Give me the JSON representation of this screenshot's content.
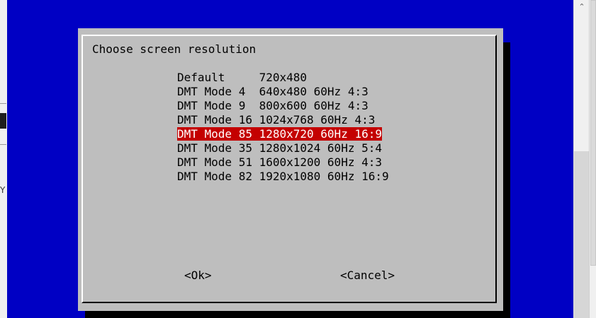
{
  "dialog": {
    "prompt": "Choose screen resolution",
    "items": [
      {
        "label": "Default     720x480"
      },
      {
        "label": "DMT Mode 4  640x480 60Hz 4:3"
      },
      {
        "label": "DMT Mode 9  800x600 60Hz 4:3"
      },
      {
        "label": "DMT Mode 16 1024x768 60Hz 4:3"
      },
      {
        "label": "DMT Mode 85 1280x720 60Hz 16:9",
        "selected": true
      },
      {
        "label": "DMT Mode 35 1280x1024 60Hz 5:4"
      },
      {
        "label": "DMT Mode 51 1600x1200 60Hz 4:3"
      },
      {
        "label": "DMT Mode 82 1920x1080 60Hz 16:9"
      }
    ],
    "ok_label": "<Ok>",
    "cancel_label": "<Cancel>"
  },
  "left_strip": {
    "glyph": "Y"
  },
  "scrollbar": {
    "up_arrow_icon": "chevron-up-icon"
  },
  "colors": {
    "terminal_background": "#0000c4",
    "dialog_background": "#bebebe",
    "selection_background": "#c40000",
    "selection_text": "#ffffff",
    "dialog_shadow": "#000000"
  }
}
